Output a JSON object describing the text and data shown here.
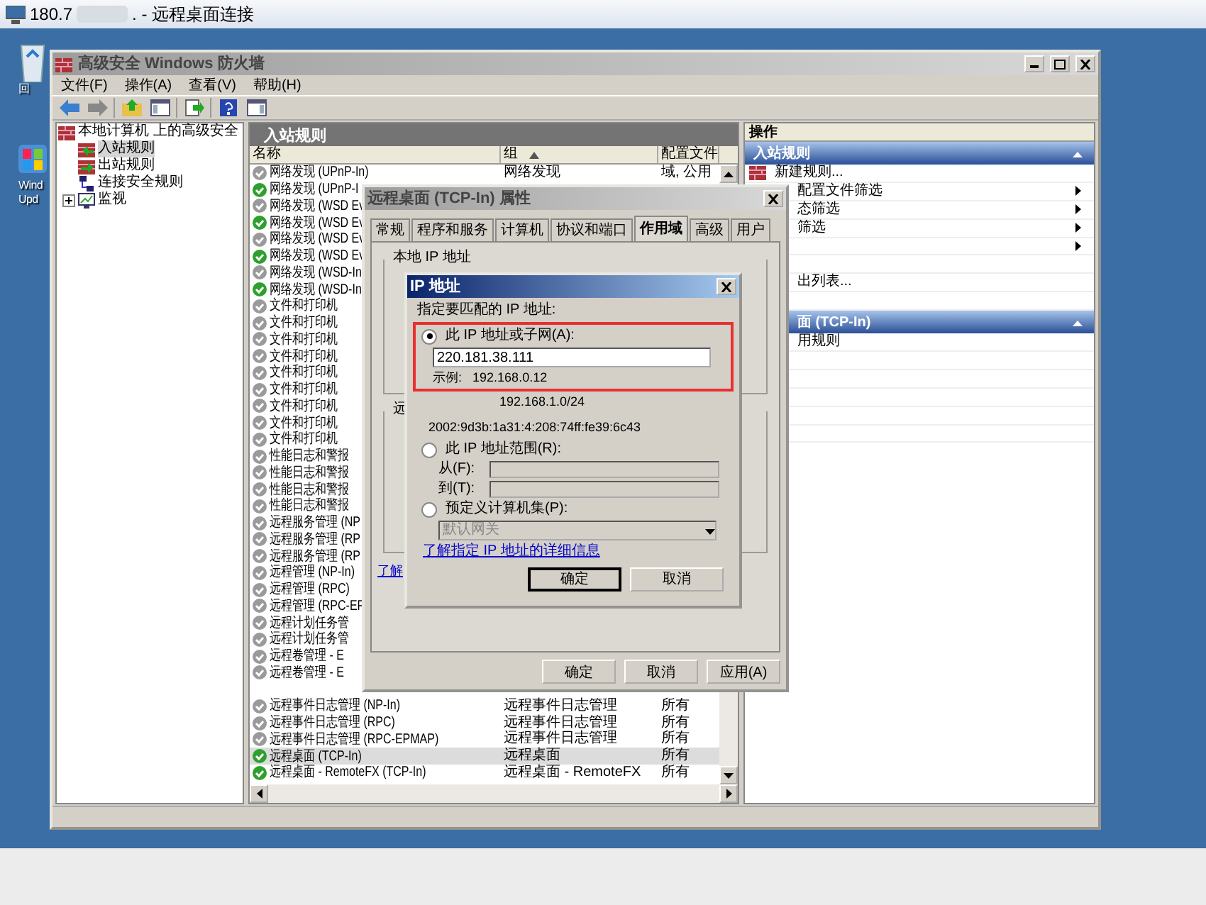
{
  "rdp_window": {
    "title_start": "180.7",
    "title_end": ". - 远程桌面连接"
  },
  "desktop_icons": [
    {
      "kind": "recycle",
      "lines": [
        "回"
      ]
    },
    {
      "kind": "update",
      "lines": [
        "Wind",
        "Upd"
      ]
    }
  ],
  "mmc": {
    "title": "高级安全 Windows 防火墙",
    "menu": [
      "文件(F)",
      "操作(A)",
      "查看(V)",
      "帮助(H)"
    ],
    "toolbar": [
      {
        "kind": "back"
      },
      {
        "kind": "forward"
      },
      {
        "kind": "separator"
      },
      {
        "kind": "up"
      },
      {
        "kind": "tree"
      },
      {
        "kind": "separator"
      },
      {
        "kind": "export"
      },
      {
        "kind": "separator"
      },
      {
        "kind": "help"
      },
      {
        "kind": "pane"
      }
    ],
    "tree": {
      "label": "本地计算机 上的高级安全",
      "children": [
        {
          "label": "入站规则",
          "kind": "inbound",
          "selected": true,
          "expander": false
        },
        {
          "label": "出站规则",
          "kind": "outbound",
          "selected": false,
          "expander": false
        },
        {
          "label": "连接安全规则",
          "kind": "security",
          "selected": false,
          "expander": false
        },
        {
          "label": "监视",
          "kind": "monitor",
          "selected": false,
          "expander": true
        }
      ]
    },
    "center": {
      "header": "入站规则",
      "columns": [
        "名称",
        "组",
        "配置文件"
      ],
      "rows": [
        {
          "name": "网络发现 (UPnP-In)",
          "group": "网络发现",
          "profile": "域, 公用",
          "enabled": false,
          "selected": false
        },
        {
          "name": "网络发现 (UPnP-I",
          "enabled": true,
          "selected": false
        },
        {
          "name": "网络发现 (WSD Ev",
          "enabled": false,
          "selected": false
        },
        {
          "name": "网络发现 (WSD Ev",
          "enabled": true,
          "selected": false
        },
        {
          "name": "网络发现 (WSD Ev",
          "enabled": false,
          "selected": false
        },
        {
          "name": "网络发现 (WSD Ev",
          "enabled": true,
          "selected": false
        },
        {
          "name": "网络发现 (WSD-In",
          "enabled": false,
          "selected": false
        },
        {
          "name": "网络发现 (WSD-In",
          "enabled": true,
          "selected": false
        },
        {
          "name": "文件和打印机",
          "enabled": false,
          "selected": false
        },
        {
          "name": "文件和打印机",
          "enabled": false,
          "selected": false
        },
        {
          "name": "文件和打印机",
          "enabled": false,
          "selected": false
        },
        {
          "name": "文件和打印机",
          "enabled": false,
          "selected": false
        },
        {
          "name": "文件和打印机",
          "enabled": false,
          "selected": false
        },
        {
          "name": "文件和打印机",
          "enabled": false,
          "selected": false
        },
        {
          "name": "文件和打印机",
          "enabled": false,
          "selected": false
        },
        {
          "name": "文件和打印机",
          "enabled": false,
          "selected": false
        },
        {
          "name": "文件和打印机",
          "enabled": false,
          "selected": false
        },
        {
          "name": "性能日志和警报",
          "enabled": false,
          "selected": false
        },
        {
          "name": "性能日志和警报",
          "enabled": false,
          "selected": false
        },
        {
          "name": "性能日志和警报",
          "enabled": false,
          "selected": false
        },
        {
          "name": "性能日志和警报",
          "enabled": false,
          "selected": false
        },
        {
          "name": "远程服务管理 (NP",
          "enabled": false,
          "selected": false
        },
        {
          "name": "远程服务管理 (RP",
          "enabled": false,
          "selected": false
        },
        {
          "name": "远程服务管理 (RP",
          "enabled": false,
          "selected": false
        },
        {
          "name": "远程管理 (NP-In)",
          "enabled": false,
          "selected": false
        },
        {
          "name": "远程管理 (RPC)",
          "enabled": false,
          "selected": false
        },
        {
          "name": "远程管理 (RPC-EP",
          "enabled": false,
          "selected": false
        },
        {
          "name": "远程计划任务管",
          "enabled": false,
          "selected": false
        },
        {
          "name": "远程计划任务管",
          "enabled": false,
          "selected": false
        },
        {
          "name": "远程卷管理 - E",
          "enabled": false,
          "selected": false
        },
        {
          "name": "远程卷管理 - E",
          "enabled": false,
          "selected": false
        },
        {
          "selected": false
        },
        {
          "name": "远程事件日志管理 (NP-In)",
          "group": "远程事件日志管理",
          "profile": "所有",
          "enabled": false,
          "selected": false
        },
        {
          "name": "远程事件日志管理 (RPC)",
          "group": "远程事件日志管理",
          "profile": "所有",
          "enabled": false,
          "selected": false
        },
        {
          "name": "远程事件日志管理 (RPC-EPMAP)",
          "group": "远程事件日志管理",
          "profile": "所有",
          "enabled": false,
          "selected": false
        },
        {
          "name": "远程桌面 (TCP-In)",
          "group": "远程桌面",
          "profile": "所有",
          "enabled": true,
          "selected": true
        },
        {
          "name": "远程桌面 - RemoteFX (TCP-In)",
          "group": "远程桌面 - RemoteFX",
          "profile": "所有",
          "enabled": true,
          "selected": false
        }
      ]
    },
    "actions": {
      "header": "操作",
      "sections": [
        {
          "title": "入站规则",
          "covered": false,
          "items": [
            {
              "label": "新建规则...",
              "covered": false,
              "submenu": false
            },
            {
              "label": "配置文件筛选",
              "covered": true,
              "submenu": true
            },
            {
              "label": "态筛选",
              "covered": true,
              "submenu": true
            },
            {
              "label": "筛选",
              "covered": true,
              "submenu": true
            },
            {
              "submenu": true
            },
            {
              "submenu": false
            },
            {
              "label": "出列表...",
              "covered": true,
              "submenu": false
            },
            {
              "submenu": false
            }
          ]
        },
        {
          "title": "面 (TCP-In)",
          "covered": true,
          "items": [
            {
              "label": "用规则",
              "covered": true,
              "submenu": false
            },
            {
              "submenu": false
            },
            {
              "submenu": false
            },
            {
              "submenu": false
            },
            {
              "submenu": false
            },
            {
              "submenu": false
            }
          ]
        }
      ]
    }
  },
  "properties_dialog": {
    "title": "远程桌面 (TCP-In) 属性",
    "tabs": [
      {
        "label": "常规",
        "selected": false
      },
      {
        "label": "程序和服务",
        "selected": false
      },
      {
        "label": "计算机",
        "selected": false
      },
      {
        "label": "协议和端口",
        "selected": false
      },
      {
        "label": "作用域",
        "selected": true
      },
      {
        "label": "高级",
        "selected": false
      },
      {
        "label": "用户",
        "selected": false
      }
    ],
    "groups": [
      {
        "label": "本地 IP 地址"
      },
      {
        "label": "远"
      }
    ],
    "link": "了解",
    "buttons": [
      "确定",
      "取消",
      "应用(A)"
    ]
  },
  "ip_dialog": {
    "title": "IP 地址",
    "prompt": "指定要匹配的 IP 地址:",
    "options": [
      {
        "kind": "address",
        "label": "此 IP 地址或子网(A):",
        "selected": true,
        "highlighted": true,
        "value": "220.181.38.111",
        "example_label": "示例:",
        "examples": [
          "192.168.0.12",
          "192.168.1.0/24",
          "2002:9d3b:1a31:4:208:74ff:fe39:6c43"
        ]
      },
      {
        "kind": "range",
        "label": "此 IP 地址范围(R):",
        "selected": false,
        "highlighted": false,
        "fields": [
          "从(F):",
          "到(T):"
        ]
      },
      {
        "kind": "preset",
        "label": "预定义计算机集(P):",
        "selected": false,
        "highlighted": false,
        "value": "默认网关",
        "disabled": true
      }
    ],
    "link": "了解指定 IP 地址的详细信息",
    "buttons": [
      {
        "label": "确定",
        "default": true
      },
      {
        "label": "取消",
        "default": false
      }
    ]
  }
}
